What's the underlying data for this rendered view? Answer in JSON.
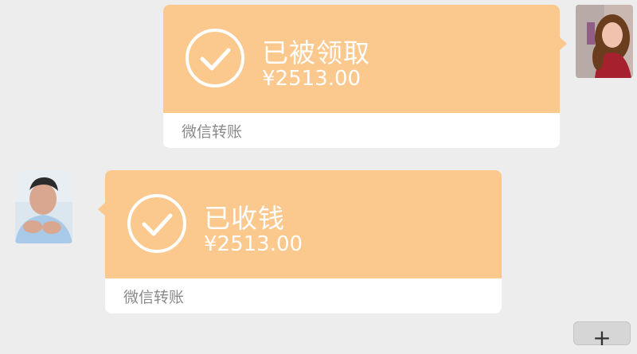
{
  "messages": [
    {
      "side": "right",
      "status": "已被领取",
      "amount": "¥2513.00",
      "label": "微信转账",
      "avatar": "woman-avatar"
    },
    {
      "side": "left",
      "status": "已收钱",
      "amount": "¥2513.00",
      "label": "微信转账",
      "avatar": "man-avatar"
    }
  ],
  "icons": {
    "check": "check-circle-icon",
    "plus": "plus-icon"
  },
  "colors": {
    "background": "#ededed",
    "transfer_orange": "#fbc88e",
    "white": "#ffffff",
    "label_gray": "#8a8a8a"
  },
  "plus_button": {
    "label": "+"
  }
}
